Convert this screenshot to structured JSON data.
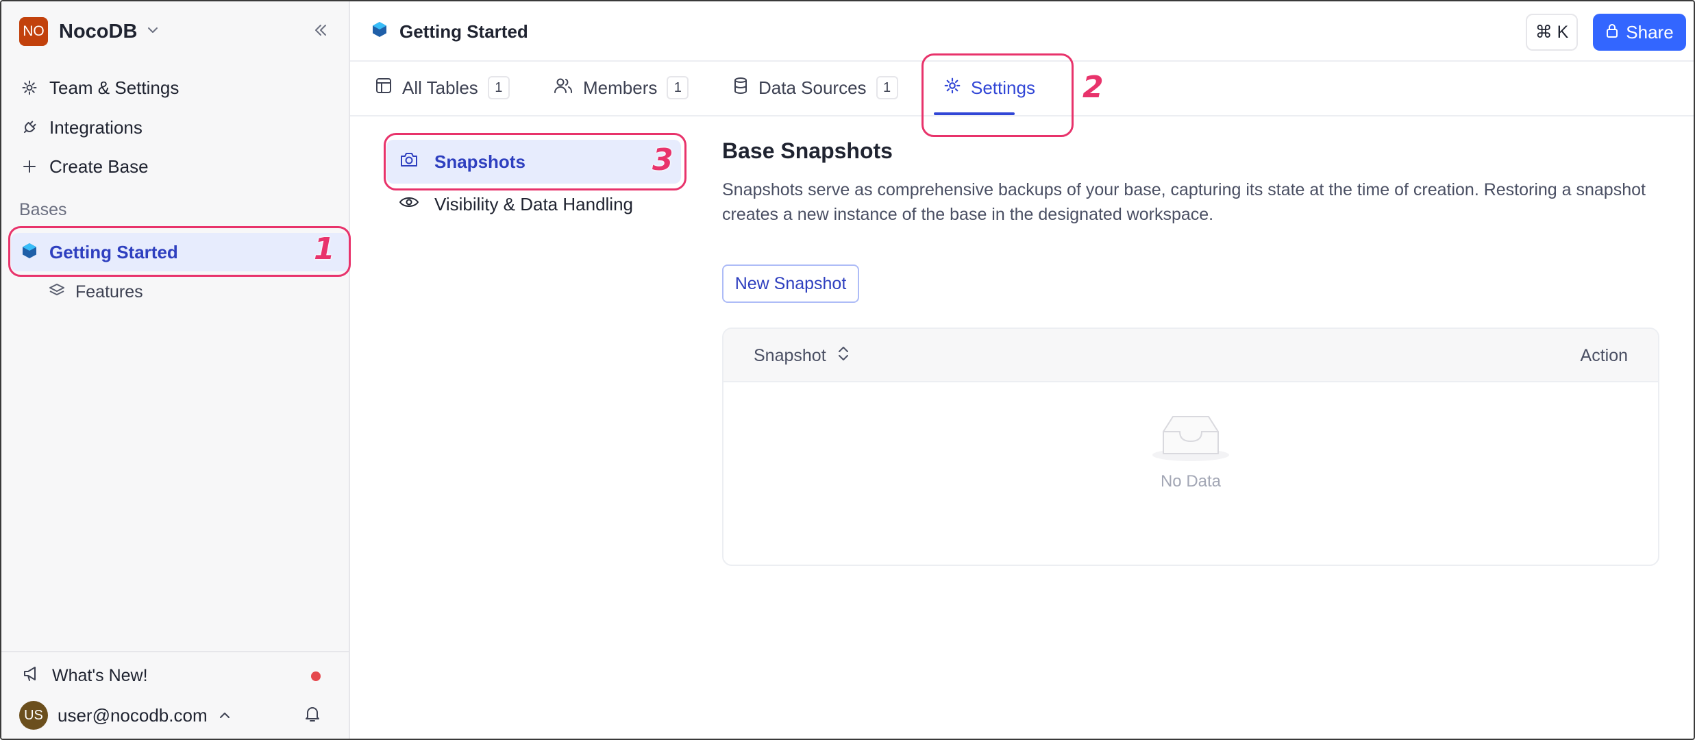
{
  "workspace": {
    "initials": "NO",
    "name": "NocoDB"
  },
  "sidebar": {
    "items": [
      {
        "label": "Team & Settings",
        "icon": "gear-icon"
      },
      {
        "label": "Integrations",
        "icon": "plug-icon"
      },
      {
        "label": "Create Base",
        "icon": "plus-icon"
      }
    ],
    "section_label": "Bases",
    "base": {
      "label": "Getting Started",
      "icon": "base-cube-icon"
    },
    "sub_items": [
      {
        "label": "Features",
        "icon": "layers-icon"
      }
    ],
    "whats_new": "What's New!",
    "user": {
      "initials": "US",
      "email": "user@nocodb.com"
    }
  },
  "topbar": {
    "title": "Getting Started",
    "cmdk": "⌘ K",
    "share_label": "Share"
  },
  "tabs": [
    {
      "label": "All Tables",
      "count": "1",
      "icon": "table-icon"
    },
    {
      "label": "Members",
      "count": "1",
      "icon": "users-icon"
    },
    {
      "label": "Data Sources",
      "count": "1",
      "icon": "database-icon"
    },
    {
      "label": "Settings",
      "icon": "gear-icon",
      "active": true
    }
  ],
  "settings_nav": [
    {
      "label": "Snapshots",
      "icon": "camera-icon",
      "active": true
    },
    {
      "label": "Visibility & Data Handling",
      "icon": "eye-icon"
    }
  ],
  "content": {
    "title": "Base Snapshots",
    "description": "Snapshots serve as comprehensive backups of your base, capturing its state at the time of creation. Restoring a snapshot creates a new instance of the base in the designated workspace.",
    "new_button": "New Snapshot",
    "table": {
      "columns": [
        "Snapshot",
        "Action"
      ],
      "empty_text": "No Data"
    }
  },
  "annotations": [
    "1",
    "2",
    "3"
  ],
  "colors": {
    "accent": "#3366ff",
    "active_text": "#2e3fbf",
    "highlight": "#e8336b",
    "workspace_avatar": "#c2410c"
  }
}
